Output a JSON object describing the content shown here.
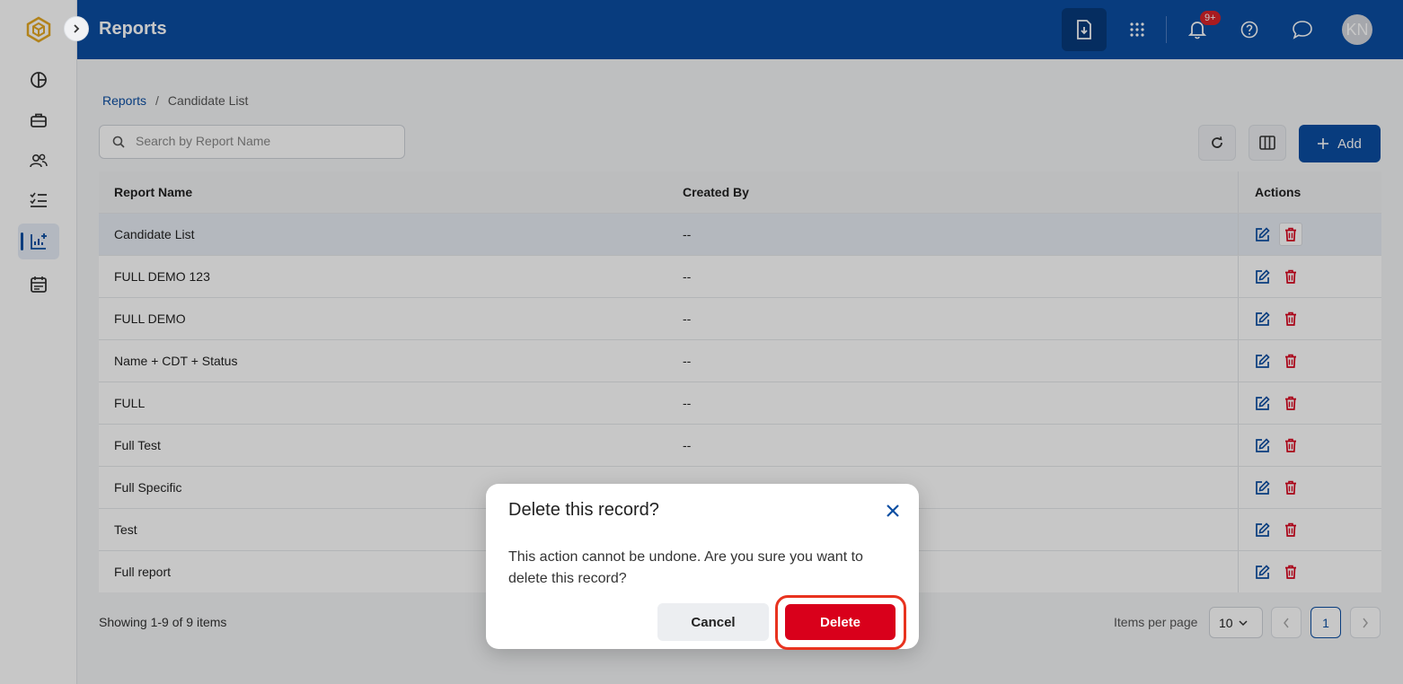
{
  "header": {
    "title": "Reports",
    "notification_badge": "9+",
    "avatar_initials": "KN"
  },
  "breadcrumb": {
    "root": "Reports",
    "separator": "/",
    "current": "Candidate List"
  },
  "search": {
    "placeholder": "Search by Report Name",
    "value": ""
  },
  "toolbar": {
    "add_label": "Add"
  },
  "table": {
    "columns": [
      "Report Name",
      "Created By",
      "Actions"
    ],
    "rows": [
      {
        "name": "Candidate List",
        "created_by": "--"
      },
      {
        "name": "FULL DEMO 123",
        "created_by": "--"
      },
      {
        "name": "FULL DEMO",
        "created_by": "--"
      },
      {
        "name": "Name + CDT + Status",
        "created_by": "--"
      },
      {
        "name": "FULL",
        "created_by": "--"
      },
      {
        "name": "Full Test",
        "created_by": "--"
      },
      {
        "name": "Full Specific",
        "created_by": ""
      },
      {
        "name": "Test",
        "created_by": ""
      },
      {
        "name": "Full report",
        "created_by": ""
      }
    ]
  },
  "footer": {
    "showing": "Showing 1-9 of 9 items",
    "items_per_page_label": "Items per page",
    "items_per_page": "10",
    "current_page": "1"
  },
  "dialog": {
    "title": "Delete this record?",
    "message": "This action cannot be undone. Are you sure you want to delete this record?",
    "cancel_label": "Cancel",
    "delete_label": "Delete"
  },
  "colors": {
    "brand": "#0b4ea2",
    "danger": "#d9001b",
    "highlight_ring": "#e8331f"
  }
}
